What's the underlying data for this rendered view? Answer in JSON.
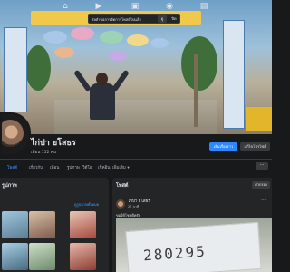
{
  "nav": {
    "toast_text": "ส่งคำขอการจัดการโพสต์ไปแล้ว",
    "toast_action": "ดู",
    "toast_close": "ปิด"
  },
  "profile": {
    "name": "ไก่ป่า ยโสธร",
    "friends": "เพื่อน 152 คน",
    "add_story": "เพิ่มเรื่องราว",
    "edit_profile": "แก้ไขโปรไฟล์"
  },
  "tabs": [
    {
      "label": "โพสต์"
    },
    {
      "label": "เกี่ยวกับ"
    },
    {
      "label": "เพื่อน"
    },
    {
      "label": "รูปภาพ"
    },
    {
      "label": "วิดีโอ"
    },
    {
      "label": "เช็คอิน"
    },
    {
      "label": "เพิ่มเติม ▾"
    }
  ],
  "more_label": "···",
  "left_panel": {
    "title": "รูปภาพ",
    "link": "ดูรูปภาพทั้งหมด"
  },
  "posts": {
    "title": "โพสต์",
    "filter": "ตัวกรอง",
    "author": "ไก่ป่า ยโสธร",
    "time": "27 นาที",
    "text": "ขอให้โชคดีครับ",
    "ticket_number": "280295"
  },
  "colors": {
    "background": "#18191a",
    "card": "#242526",
    "accent": "#2d88ff"
  }
}
